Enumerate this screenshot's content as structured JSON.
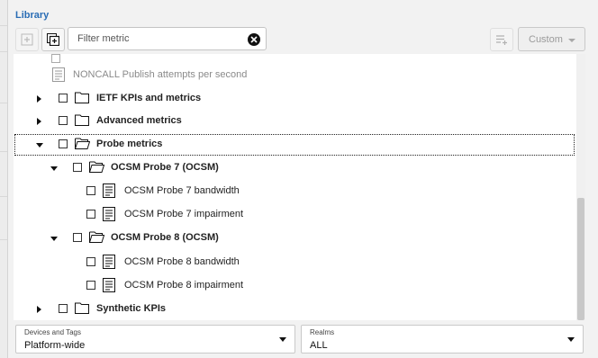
{
  "library": {
    "title": "Library"
  },
  "toolbar": {
    "filter_placeholder": "Filter metric",
    "custom_label": "Custom"
  },
  "tree": {
    "partial_top_label": "NONCALL Publish attempts per second",
    "items": [
      {
        "label": "IETF KPIs and metrics",
        "expanded": false
      },
      {
        "label": "Advanced metrics",
        "expanded": false
      },
      {
        "label": "Probe metrics",
        "expanded": true
      },
      {
        "label": "OCSM Probe 7 (OCSM)",
        "expanded": true
      },
      {
        "label": "OCSM Probe 7 bandwidth"
      },
      {
        "label": "OCSM Probe 7 impairment"
      },
      {
        "label": "OCSM Probe 8 (OCSM)",
        "expanded": true
      },
      {
        "label": "OCSM Probe 8 bandwidth"
      },
      {
        "label": "OCSM Probe 8 impairment"
      },
      {
        "label": "Synthetic KPIs",
        "expanded": false
      }
    ]
  },
  "devices": {
    "caption": "Devices and Tags",
    "value": "Platform-wide"
  },
  "realms": {
    "caption": "Realms",
    "value": "ALL"
  },
  "colors": {
    "title_blue": "#2a6db5",
    "panel_bg": "#f2f2f2"
  }
}
